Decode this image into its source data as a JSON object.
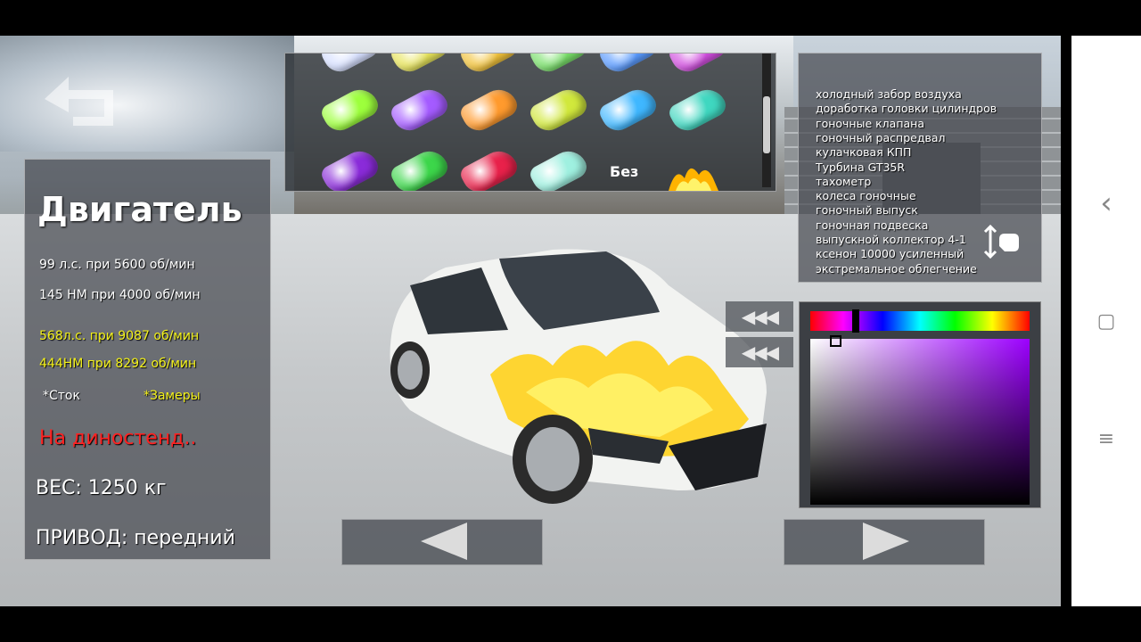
{
  "engine": {
    "title": "Двигатель",
    "stock_power": "99 л.с. при 5600 об/мин",
    "stock_torque": "145 НМ при 4000 об/мин",
    "tuned_power": "568л.с. при 9087 об/мин",
    "tuned_torque": "444НМ при 8292 об/мин",
    "stock_label": "*Сток",
    "measured_label": "*Замеры",
    "dyno_link": "На диностенд..",
    "weight": "ВЕС: 1250 кг",
    "drive": "ПРИВОД: передний"
  },
  "paint": {
    "no_vinyl_label": "Без",
    "swatch_colors": [
      [
        "#d7e0ff",
        "#e7e45a",
        "#f2c33b",
        "#79e06a",
        "#5a9bff",
        "#d24fe0"
      ],
      [
        "#9dff3c",
        "#a45bff",
        "#ff9a2d",
        "#d1e83c",
        "#3fb7ff",
        "#3fd7c0"
      ],
      [
        "#8a2bd9",
        "#3cd64a",
        "#e8214a",
        "#9ff0e0"
      ]
    ]
  },
  "upgrades": [
    "холодный забор воздуха",
    "доработка головки цилиндров",
    "гоночные клапана",
    "гоночный распредвал",
    "кулачковая КПП",
    "Турбина GT35R",
    "тахометр",
    "колеса гоночные",
    "гоночный выпуск",
    "гоночная подвеска",
    "выпускной коллектор 4-1",
    "ксенон 10000 усиленный",
    "экстремальное облегчение"
  ],
  "rewind_label": "◀◀◀",
  "color_picker": {
    "hue_color": "#9c00ff"
  },
  "system_nav": {
    "back": "‹",
    "home": "▢",
    "menu": "≡"
  }
}
